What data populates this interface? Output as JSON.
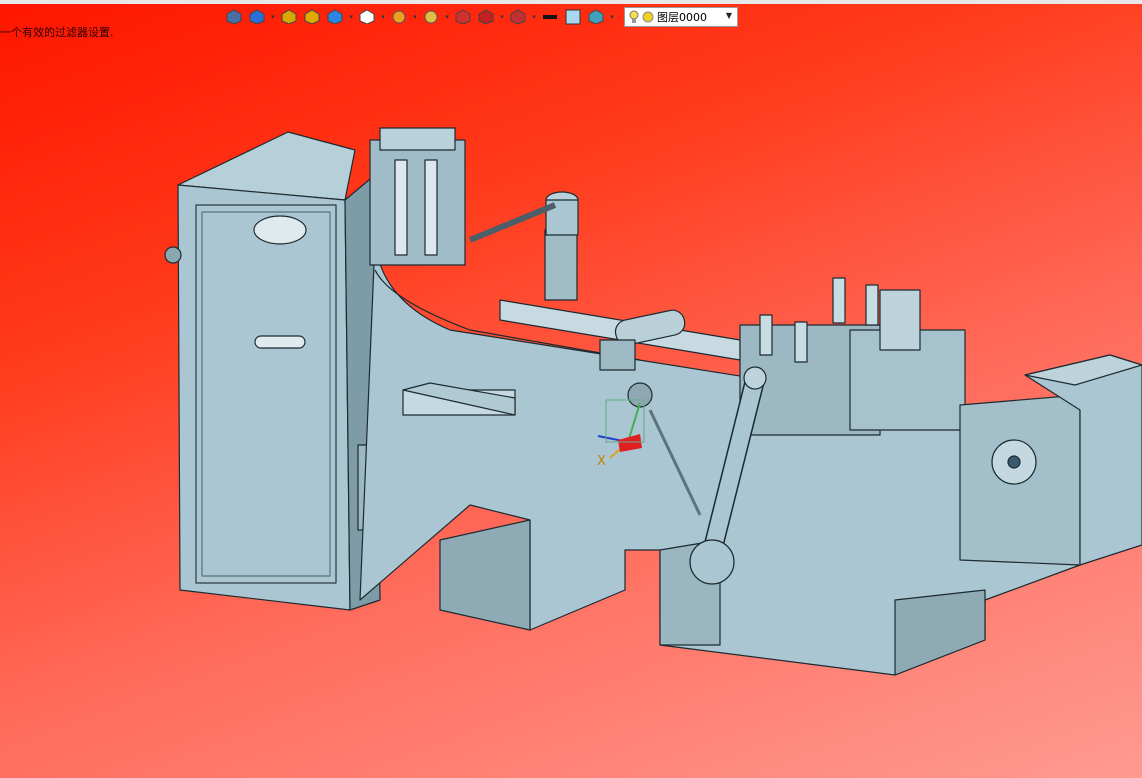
{
  "status": {
    "message": "一个有效的过滤器设置."
  },
  "toolbar": {
    "buttons": [
      {
        "name": "exit-icon",
        "color": "#4a6fa5",
        "caret": false
      },
      {
        "name": "view-orient-icon",
        "color": "#2a6fd6",
        "caret": true
      },
      {
        "name": "sketch-pen-icon",
        "color": "#d6a800",
        "caret": false
      },
      {
        "name": "solid-box-icon",
        "color": "#e0a800",
        "caret": false
      },
      {
        "name": "shaded-cube-icon",
        "color": "#2a86e0",
        "caret": true
      },
      {
        "name": "wire-cube-icon",
        "color": "#ffffff",
        "caret": true
      },
      {
        "name": "section-view-icon",
        "color": "#f0a020",
        "caret": true
      },
      {
        "name": "zoom-icon",
        "color": "#e0c040",
        "caret": true
      },
      {
        "name": "fit-view-icon",
        "color": "#d03030",
        "caret": false
      },
      {
        "name": "clip-plane-icon",
        "color": "#c02020",
        "caret": true
      },
      {
        "name": "display-mode-icon",
        "color": "#c03030",
        "caret": true
      },
      {
        "name": "line-color-icon",
        "color": "#111111",
        "caret": false
      },
      {
        "name": "fill-color-icon",
        "color": "#a8d8f0",
        "caret": false
      },
      {
        "name": "material-icon",
        "color": "#40a0c0",
        "caret": true
      }
    ],
    "layer": {
      "label": "图层0000",
      "bulb_color": "#f7e04a",
      "dot_color": "#f0d020"
    }
  },
  "model": {
    "body_color": "#a9c6d2",
    "dark_color": "#6f8f9c",
    "edge_color": "#1d2a30"
  },
  "triad": {
    "x_label": "X"
  }
}
